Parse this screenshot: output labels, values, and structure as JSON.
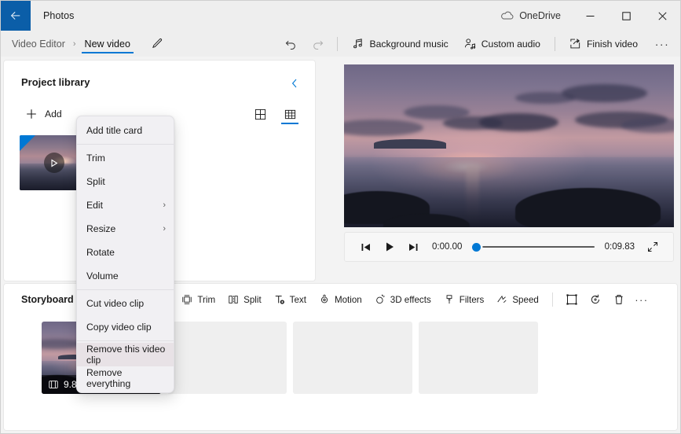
{
  "titlebar": {
    "app_name": "Photos",
    "back_icon": "back-arrow-icon",
    "onedrive_label": "OneDrive",
    "onedrive_icon": "cloud-icon",
    "minimize_label": "─",
    "maximize_label": "□",
    "close_label": "✕",
    "accent_color": "#0b5ea8"
  },
  "commandbar": {
    "breadcrumb_root": "Video Editor",
    "breadcrumb_sep": "›",
    "breadcrumb_current": "New video",
    "rename_icon": "pencil-icon",
    "undo_icon": "undo-icon",
    "redo_icon": "redo-icon",
    "background_music": "Background music",
    "background_music_icon": "music-note-icon",
    "custom_audio": "Custom audio",
    "custom_audio_icon": "person-audio-icon",
    "finish_video": "Finish video",
    "finish_video_icon": "export-icon",
    "overflow_label": "···",
    "accent_color": "#0078d4"
  },
  "library": {
    "title": "Project library",
    "collapse_icon": "chevron-left-icon",
    "add_label": "Add",
    "add_icon": "plus-icon",
    "view_large_icon": "grid-large-icon",
    "view_small_icon": "grid-small-icon",
    "active_view": "grid-small",
    "clip_play_icon": "play-icon"
  },
  "preview": {
    "current_time": "0:00.00",
    "total_time": "0:09.83",
    "progress_percent": 0,
    "prev_frame_icon": "previous-frame-icon",
    "play_icon": "play-icon",
    "next_frame_icon": "next-frame-icon",
    "fullscreen_icon": "expand-icon",
    "scrubber_color": "#0078d4"
  },
  "storyboard": {
    "title": "Storyboard",
    "tools": [
      {
        "label": "Add title card",
        "icon": "title-card-icon"
      },
      {
        "label": "Trim",
        "icon": "trim-icon"
      },
      {
        "label": "Split",
        "icon": "split-icon"
      },
      {
        "label": "Text",
        "icon": "text-icon"
      },
      {
        "label": "Motion",
        "icon": "motion-icon"
      },
      {
        "label": "3D effects",
        "icon": "3d-effects-icon"
      },
      {
        "label": "Filters",
        "icon": "filters-icon"
      },
      {
        "label": "Speed",
        "icon": "speed-icon"
      }
    ],
    "icon_tools": [
      {
        "name": "aspect-ratio-icon"
      },
      {
        "name": "rotate-icon"
      },
      {
        "name": "delete-icon"
      }
    ],
    "overflow_label": "···",
    "clip": {
      "duration": "9.81",
      "duration_icon": "filmstrip-icon",
      "volume_icon": "volume-icon",
      "selected": true
    },
    "empty_slots": 3
  },
  "context_menu": {
    "items": [
      {
        "label": "Add title card",
        "submenu": false,
        "highlighted": false,
        "separator_after": true
      },
      {
        "label": "Trim",
        "submenu": false,
        "highlighted": false,
        "separator_after": false
      },
      {
        "label": "Split",
        "submenu": false,
        "highlighted": false,
        "separator_after": false
      },
      {
        "label": "Edit",
        "submenu": true,
        "highlighted": false,
        "separator_after": false
      },
      {
        "label": "Resize",
        "submenu": true,
        "highlighted": false,
        "separator_after": false
      },
      {
        "label": "Rotate",
        "submenu": false,
        "highlighted": false,
        "separator_after": false
      },
      {
        "label": "Volume",
        "submenu": false,
        "highlighted": false,
        "separator_after": true
      },
      {
        "label": "Cut video clip",
        "submenu": false,
        "highlighted": false,
        "separator_after": false
      },
      {
        "label": "Copy video clip",
        "submenu": false,
        "highlighted": false,
        "separator_after": true
      },
      {
        "label": "Remove this video clip",
        "submenu": false,
        "highlighted": true,
        "separator_after": false
      },
      {
        "label": "Remove everything",
        "submenu": false,
        "highlighted": false,
        "separator_after": false
      }
    ],
    "submenu_chevron": "›"
  }
}
